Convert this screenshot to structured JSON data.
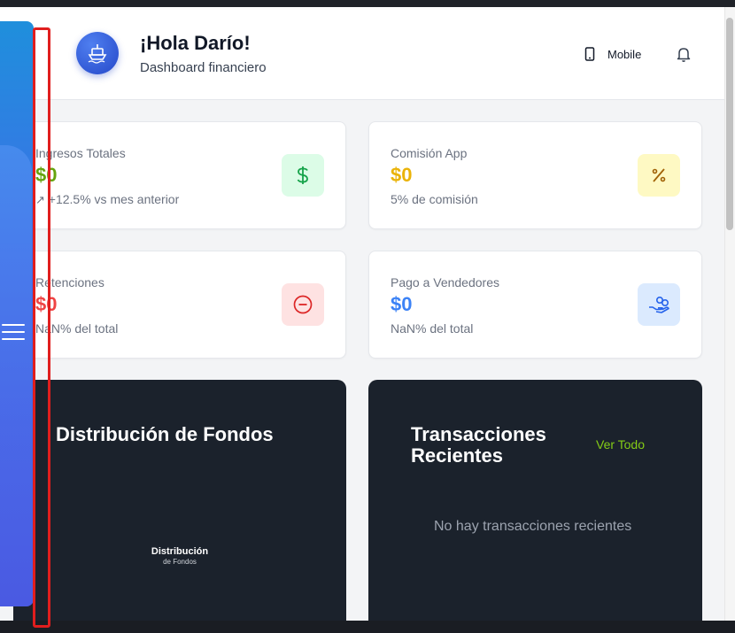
{
  "header": {
    "greeting": "¡Hola Darío!",
    "subtitle": "Dashboard financiero",
    "mobile_label": "Mobile"
  },
  "cards": [
    {
      "label": "Ingresos Totales",
      "value": "$0",
      "note": "+12.5% vs mes anterior",
      "value_color": "#65a30d",
      "icon": "dollar-icon",
      "icon_bg": "#dcfce7",
      "icon_color": "#16a34a"
    },
    {
      "label": "Comisión App",
      "value": "$0",
      "note": "5% de comisión",
      "value_color": "#eab308",
      "icon": "percent-icon",
      "icon_bg": "#fef9c3",
      "icon_color": "#a16207"
    },
    {
      "label": "Retenciones",
      "value": "$0",
      "note": "NaN% del total",
      "value_color": "#ef4444",
      "icon": "minus-circle-icon",
      "icon_bg": "#fee2e2",
      "icon_color": "#dc2626"
    },
    {
      "label": "Pago a Vendedores",
      "value": "$0",
      "note": "NaN% del total",
      "value_color": "#3b82f6",
      "icon": "hand-coins-icon",
      "icon_bg": "#dbeafe",
      "icon_color": "#2563eb"
    }
  ],
  "distribution": {
    "title": "Distribución de Fondos",
    "center_title": "Distribución",
    "center_sub": "de Fondos"
  },
  "transactions": {
    "title_line1": "Transacciones",
    "title_line2": "Recientes",
    "view_all": "Ver Todo",
    "empty": "No hay transacciones recientes"
  }
}
